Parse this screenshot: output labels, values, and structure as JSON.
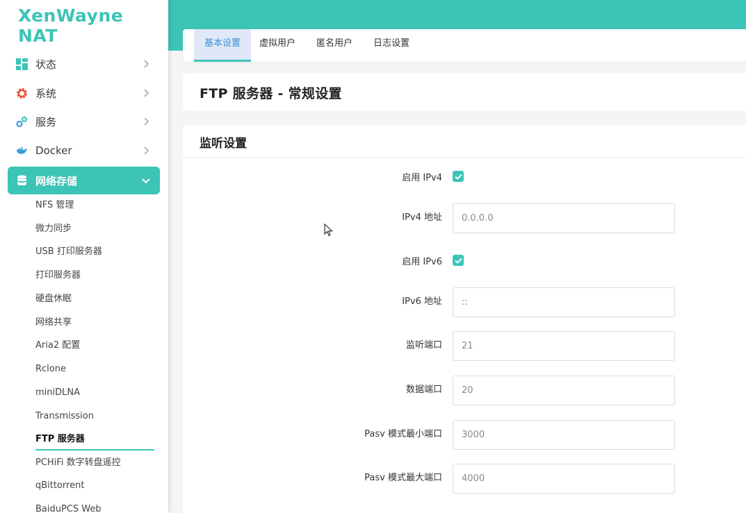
{
  "brand": {
    "logo_text": "XenWayne NAT",
    "accent": "#3cc4b6"
  },
  "sidebar": {
    "items": [
      {
        "label": "状态",
        "icon": "dashboard-icon"
      },
      {
        "label": "系统",
        "icon": "gear-icon"
      },
      {
        "label": "服务",
        "icon": "gears-icon"
      },
      {
        "label": "Docker",
        "icon": "docker-icon"
      },
      {
        "label": "网络存储",
        "icon": "database-icon",
        "expanded": true
      }
    ],
    "sub_items": [
      "NFS 管理",
      "微力同步",
      "USB 打印服务器",
      "打印服务器",
      "硬盘休眠",
      "网络共享",
      "Aria2 配置",
      "Rclone",
      "miniDLNA",
      "Transmission",
      "FTP 服务器",
      "PCHiFi 数字转盘遥控",
      "qBittorrent",
      "BaiduPCS Web"
    ],
    "current_sub": "FTP 服务器"
  },
  "tabs": [
    {
      "label": "基本设置",
      "active": true
    },
    {
      "label": "虚拟用户"
    },
    {
      "label": "匿名用户"
    },
    {
      "label": "日志设置"
    }
  ],
  "page_title": "FTP 服务器 - 常规设置",
  "section": {
    "title": "监听设置",
    "fields": {
      "enable_ipv4": {
        "label": "启用 IPv4",
        "checked": true
      },
      "ipv4_addr": {
        "label": "IPv4 地址",
        "value": "0.0.0.0"
      },
      "enable_ipv6": {
        "label": "启用 IPv6",
        "checked": true
      },
      "ipv6_addr": {
        "label": "IPv6 地址",
        "value": "::"
      },
      "listen_port": {
        "label": "监听端口",
        "value": "21"
      },
      "data_port": {
        "label": "数据端口",
        "value": "20"
      },
      "pasv_min": {
        "label": "Pasv 模式最小端口",
        "value": "3000"
      },
      "pasv_max": {
        "label": "Pasv 模式最大端口",
        "value": "4000"
      }
    }
  }
}
